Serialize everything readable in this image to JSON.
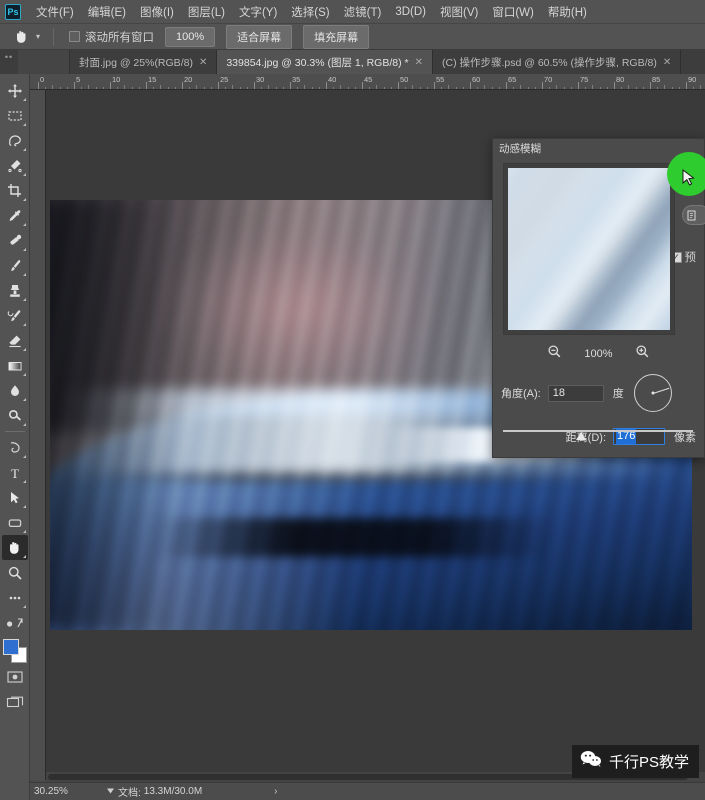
{
  "app": {
    "logo_text": "Ps",
    "background_color": "#3a3a3a"
  },
  "menubar": {
    "items": [
      {
        "label": "文件(F)"
      },
      {
        "label": "编辑(E)"
      },
      {
        "label": "图像(I)"
      },
      {
        "label": "图层(L)"
      },
      {
        "label": "文字(Y)"
      },
      {
        "label": "选择(S)"
      },
      {
        "label": "滤镜(T)"
      },
      {
        "label": "3D(D)"
      },
      {
        "label": "视图(V)"
      },
      {
        "label": "窗口(W)"
      },
      {
        "label": "帮助(H)"
      }
    ]
  },
  "optionsbar": {
    "tool_icon": "hand-icon",
    "checkbox_label": "滚动所有窗口",
    "checkbox_checked": false,
    "buttons": [
      {
        "label": "100%"
      },
      {
        "label": "适合屏幕"
      },
      {
        "label": "填充屏幕"
      }
    ]
  },
  "tabs": [
    {
      "label": "封面.jpg @ 25%(RGB/8)",
      "active": false,
      "close": "✕"
    },
    {
      "label": "339854.jpg @ 30.3% (图层 1, RGB/8) *",
      "active": true,
      "close": "✕"
    },
    {
      "label": "(C) 操作步骤.psd @ 60.5% (操作步骤, RGB/8)",
      "active": false,
      "close": "✕"
    }
  ],
  "ruler": {
    "labels": [
      "0",
      "5",
      "10",
      "15",
      "20",
      "25",
      "30",
      "35",
      "40",
      "45",
      "50",
      "55",
      "60",
      "65",
      "70",
      "75",
      "80",
      "85",
      "90"
    ],
    "unit_spacing_px": 36
  },
  "toolbar": {
    "tools": [
      {
        "name": "move-tool"
      },
      {
        "name": "rectangular-marquee-tool"
      },
      {
        "name": "lasso-tool"
      },
      {
        "name": "quick-selection-tool"
      },
      {
        "name": "crop-tool"
      },
      {
        "name": "eyedropper-tool"
      },
      {
        "name": "healing-brush-tool"
      },
      {
        "name": "brush-tool"
      },
      {
        "name": "clone-stamp-tool"
      },
      {
        "name": "history-brush-tool"
      },
      {
        "name": "eraser-tool"
      },
      {
        "name": "gradient-tool"
      },
      {
        "name": "blur-tool"
      },
      {
        "name": "dodge-tool"
      },
      {
        "name": "pen-tool"
      },
      {
        "name": "type-tool"
      },
      {
        "name": "path-selection-tool"
      },
      {
        "name": "rectangle-tool"
      },
      {
        "name": "hand-tool",
        "selected": true
      },
      {
        "name": "zoom-tool"
      },
      {
        "name": "more-tools"
      }
    ],
    "foreground_color": "#2f6fd0",
    "background_color": "#ffffff"
  },
  "dialog": {
    "title": "动感模糊",
    "preview_zoom": "100%",
    "zoom_out_icon": "zoom-out-icon",
    "zoom_in_icon": "zoom-in-icon",
    "angle": {
      "label": "角度(A):",
      "value": "18",
      "unit": "度",
      "dial_degrees": 18
    },
    "distance": {
      "label": "距离(D):",
      "value": "176",
      "unit": "像素",
      "selected": true,
      "slider_position_pct": 41
    },
    "preview_checkbox": {
      "label": "预",
      "checked": true,
      "check_glyph": "✓"
    }
  },
  "cursor": {
    "highlight_color": "#2ecc2e",
    "icon": "mouse-pointer-icon"
  },
  "statusbar": {
    "zoom": "30.25%",
    "doc_prefix": "文档:",
    "doc_size": "13.3M/30.0M",
    "arrow": "›"
  },
  "watermark": {
    "icon": "wechat-icon",
    "text": "千行PS教学"
  }
}
